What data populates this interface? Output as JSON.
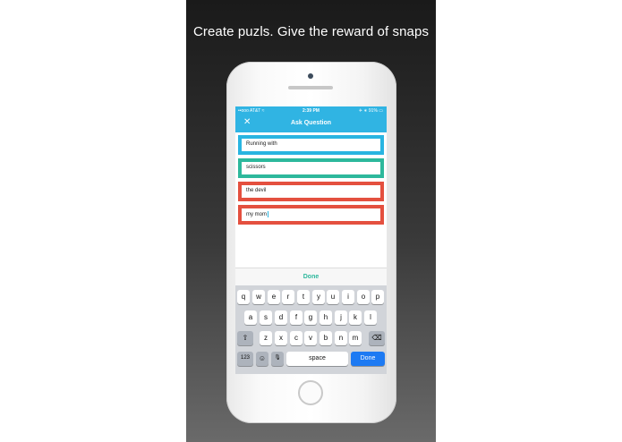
{
  "headline": "Create puzls. Give the reward of snaps",
  "status": {
    "carrier": "••ooo AT&T ≈",
    "time": "2:39 PM",
    "right": "✈ ∗ 91% ▭"
  },
  "nav": {
    "close_icon": "✕",
    "title": "Ask Question"
  },
  "fields": [
    {
      "value": "Running with",
      "color": "#29b5e1"
    },
    {
      "value": "scissors",
      "color": "#2db89c"
    },
    {
      "value": "the devil",
      "color": "#e4503f"
    },
    {
      "value": "my mom",
      "color": "#e4503f"
    }
  ],
  "toolbar": {
    "done": "Done"
  },
  "keyboard": {
    "row1": [
      "q",
      "w",
      "e",
      "r",
      "t",
      "y",
      "u",
      "i",
      "o",
      "p"
    ],
    "row2": [
      "a",
      "s",
      "d",
      "f",
      "g",
      "h",
      "j",
      "k",
      "l"
    ],
    "row3": [
      "z",
      "x",
      "c",
      "v",
      "b",
      "n",
      "m"
    ],
    "shift": "⇧",
    "delete": "⌫",
    "numbers": "123",
    "emoji": "☺",
    "mic": "🎙",
    "space": "space",
    "done": "Done"
  }
}
